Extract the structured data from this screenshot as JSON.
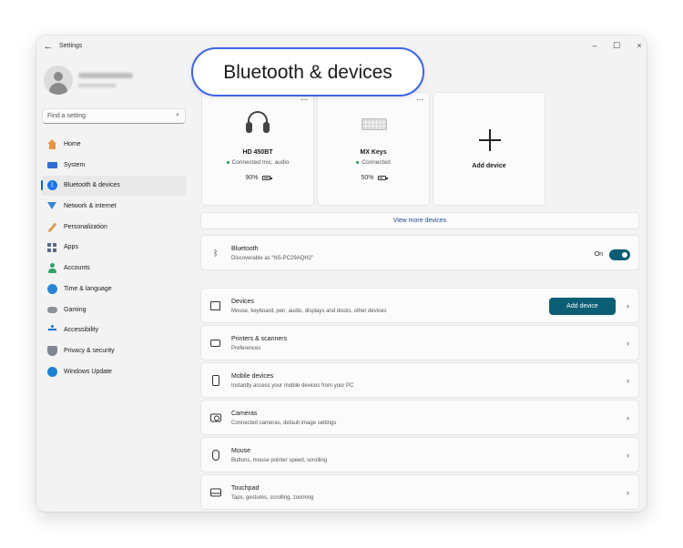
{
  "window": {
    "app_title": "Settings",
    "controls": {
      "minimize": "–",
      "maximize": "☐",
      "close": "×"
    }
  },
  "sidebar": {
    "search_placeholder": "Find a setting",
    "items": [
      {
        "label": "Home",
        "icon": "home-icon"
      },
      {
        "label": "System",
        "icon": "system-icon"
      },
      {
        "label": "Bluetooth & devices",
        "icon": "bluetooth-icon",
        "active": true
      },
      {
        "label": "Network & internet",
        "icon": "network-icon"
      },
      {
        "label": "Personalization",
        "icon": "personalization-icon"
      },
      {
        "label": "Apps",
        "icon": "apps-icon"
      },
      {
        "label": "Accounts",
        "icon": "accounts-icon"
      },
      {
        "label": "Time & language",
        "icon": "time-language-icon"
      },
      {
        "label": "Gaming",
        "icon": "gaming-icon"
      },
      {
        "label": "Accessibility",
        "icon": "accessibility-icon"
      },
      {
        "label": "Privacy & security",
        "icon": "privacy-icon"
      },
      {
        "label": "Windows Update",
        "icon": "windows-update-icon"
      }
    ]
  },
  "main": {
    "page_title": "Bluetooth & devices",
    "devices": [
      {
        "name": "HD 450BT",
        "status": "Connected mic, audio",
        "battery": "90%",
        "battery_level": 0.9,
        "icon": "headphones-icon"
      },
      {
        "name": "MX Keys",
        "status": "Connected",
        "battery": "50%",
        "battery_level": 0.5,
        "icon": "keyboard-icon"
      }
    ],
    "add_device_card": "Add device",
    "view_more": "View more devices",
    "bluetooth": {
      "title": "Bluetooth",
      "subtitle": "Discoverable as “NS-PC29AQH2”",
      "toggle_label": "On",
      "enabled": true
    },
    "rows": [
      {
        "title": "Devices",
        "subtitle": "Mouse, keyboard, pen, audio, displays and docks, other devices",
        "icon": "devices-icon",
        "button": "Add device"
      },
      {
        "title": "Printers & scanners",
        "subtitle": "Preferences",
        "icon": "printer-icon"
      },
      {
        "title": "Mobile devices",
        "subtitle": "Instantly access your mobile devices from your PC",
        "icon": "phone-icon"
      },
      {
        "title": "Cameras",
        "subtitle": "Connected cameras, default image settings",
        "icon": "camera-icon"
      },
      {
        "title": "Mouse",
        "subtitle": "Buttons, mouse pointer speed, scrolling",
        "icon": "mouse-icon"
      },
      {
        "title": "Touchpad",
        "subtitle": "Taps, gestures, scrolling, zooming",
        "icon": "touchpad-icon"
      }
    ],
    "chevron": "›",
    "dots": "⋯"
  },
  "colors": {
    "accent": "#0b5e74",
    "title_outline": "#3e63e6",
    "nav_indicator": "#0067c0"
  }
}
